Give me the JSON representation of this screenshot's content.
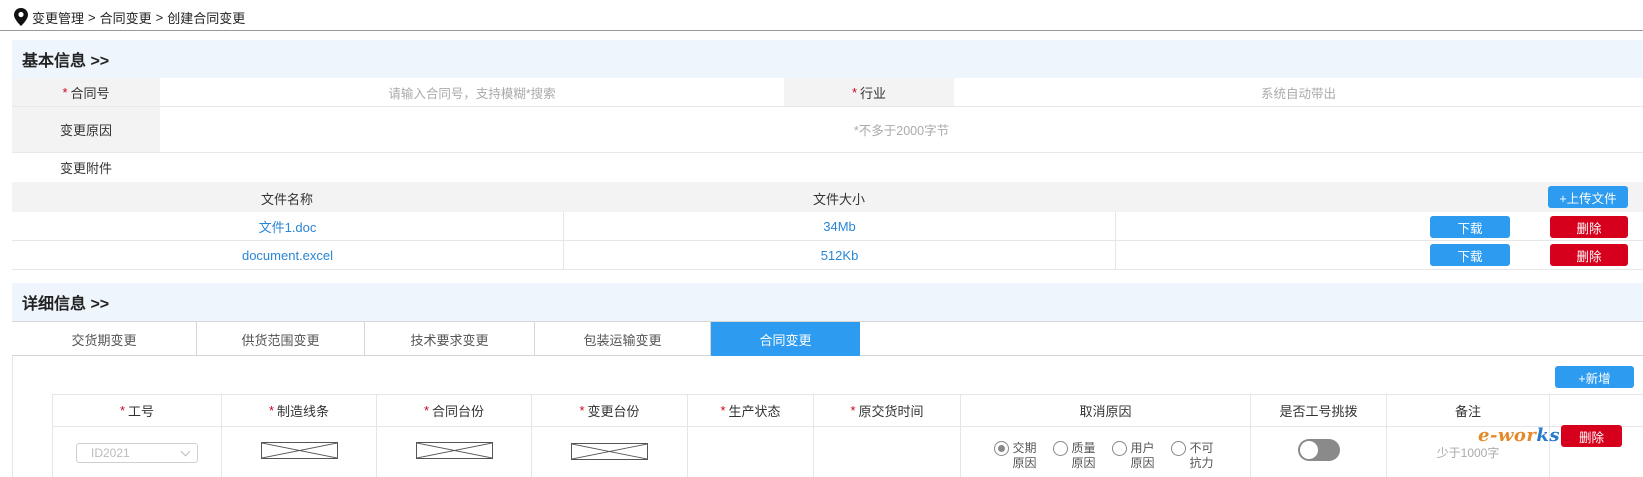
{
  "breadcrumb": [
    "变更管理",
    "合同变更",
    "创建合同变更"
  ],
  "breadcrumb_separator": ">",
  "basic_info": {
    "title": "基本信息 >>",
    "contract_no_label": "合同号",
    "contract_no_placeholder": "请输入合同号，支持模糊*搜索",
    "industry_label": "行业",
    "industry_placeholder": "系统自动带出",
    "reason_label": "变更原因",
    "reason_placeholder": "*不多于2000字节",
    "attachment_label": "变更附件"
  },
  "files": {
    "col_name": "文件名称",
    "col_size": "文件大小",
    "upload_label": "+上传文件",
    "download_label": "下载",
    "delete_label": "删除",
    "rows": [
      {
        "name": "文件1.doc",
        "size": "34Mb"
      },
      {
        "name": "document.excel",
        "size": "512Kb"
      }
    ]
  },
  "detail_info": {
    "title": "详细信息 >>",
    "tabs": [
      "交货期变更",
      "供货范围变更",
      "技术要求变更",
      "包装运输变更",
      "合同变更"
    ],
    "active_tab": 4,
    "add_label": "+新增",
    "columns": [
      "工号",
      "制造线条",
      "合同台份",
      "变更台份",
      "生产状态",
      "原交货时间",
      "取消原因",
      "是否工号挑拨",
      "备注"
    ],
    "row": {
      "id_value": "ID2021",
      "cancel_reasons": [
        "交期原因",
        "质量原因",
        "用户原因",
        "不可抗力"
      ],
      "selected_reason": 0,
      "transfer_on": false,
      "remark_placeholder": "少于1000字",
      "delete_label": "删除"
    }
  },
  "watermark": {
    "prefix": "e",
    "text": "-wor",
    "suffix": "ks"
  },
  "colors": {
    "accent": "#2d9bef",
    "danger": "#d7001c",
    "required": "#d0021b",
    "link": "#2a86d6"
  }
}
